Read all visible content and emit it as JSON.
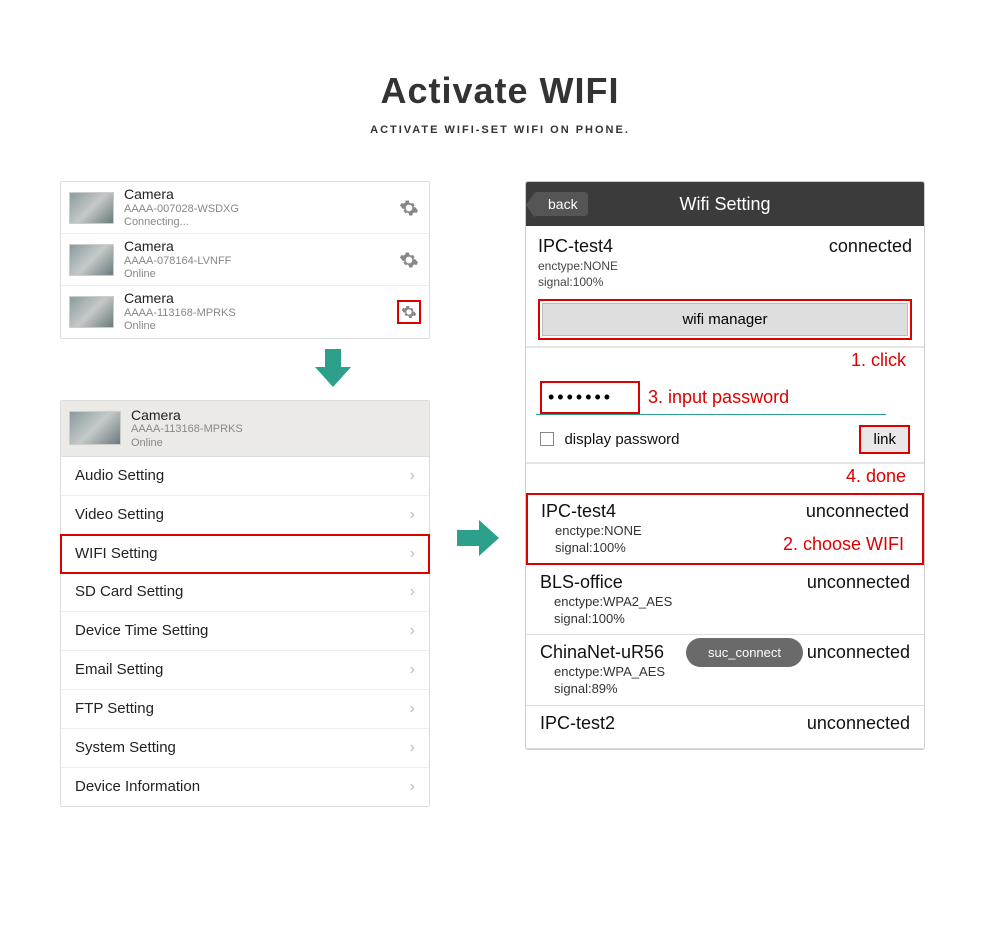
{
  "title": "Activate WIFI",
  "subtitle": "ACTIVATE WIFI-SET WIFI ON PHONE.",
  "cameras": [
    {
      "name": "Camera",
      "id": "AAAA-007028-WSDXG",
      "status": "Connecting..."
    },
    {
      "name": "Camera",
      "id": "AAAA-078164-LVNFF",
      "status": "Online"
    },
    {
      "name": "Camera",
      "id": "AAAA-113168-MPRKS",
      "status": "Online"
    }
  ],
  "selected_camera": {
    "name": "Camera",
    "id": "AAAA-113168-MPRKS",
    "status": "Online"
  },
  "settings": [
    "Audio Setting",
    "Video Setting",
    "WIFI Setting",
    "SD Card Setting",
    "Device Time Setting",
    "Email Setting",
    "FTP Setting",
    "System Setting",
    "Device Information"
  ],
  "wifi": {
    "back": "back",
    "title": "Wifi Setting",
    "connected_ssid": "IPC-test4",
    "connected_status": "connected",
    "enctype_label": "enctype:NONE",
    "signal_label": "signal:100%",
    "manager_label": "wifi manager",
    "step1": "1. click",
    "password_masked": "•••••••",
    "step3": "3. input password",
    "display_password": "display password",
    "link": "link",
    "step4": "4. done",
    "step2": "2. choose WIFI",
    "toast": "suc_connect",
    "networks": [
      {
        "ssid": "IPC-test4",
        "status": "unconnected",
        "enctype": "enctype:NONE",
        "signal": "signal:100%"
      },
      {
        "ssid": "BLS-office",
        "status": "unconnected",
        "enctype": "enctype:WPA2_AES",
        "signal": "signal:100%"
      },
      {
        "ssid": "ChinaNet-uR56",
        "status": "unconnected",
        "enctype": "enctype:WPA_AES",
        "signal": "signal:89%"
      },
      {
        "ssid": "IPC-test2",
        "status": "unconnected",
        "enctype": "",
        "signal": ""
      }
    ]
  }
}
